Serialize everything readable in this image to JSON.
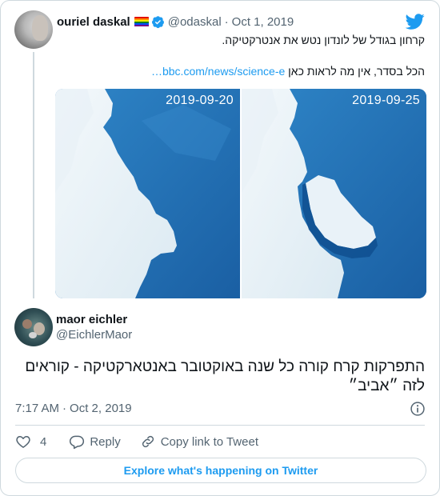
{
  "parent_tweet": {
    "author_name": "ouriel daskal",
    "handle": "@odaskal",
    "separator": "·",
    "date": "Oct 1, 2019",
    "text_line1": "קרחון בגודל של לונדון נטש את אנטרקטיקה.",
    "text_line2_prefix": "הכל בסדר, אין מה לראות כאן",
    "link_text": "bbc.com/news/science-e…",
    "images": [
      {
        "label": "2019-09-20"
      },
      {
        "label": "2019-09-25"
      }
    ]
  },
  "reply_tweet": {
    "author_name": "maor eichler",
    "handle": "@EichlerMaor",
    "text": "התפרקות קרח קורה כל שנה באוקטובר באנטארקטיקה - קוראים לזה ״אביב״",
    "time": "7:17 AM",
    "separator": "·",
    "date": "Oct 2, 2019"
  },
  "actions": {
    "like_count": "4",
    "reply_label": "Reply",
    "copy_label": "Copy link to Tweet"
  },
  "explore_label": "Explore what's happening on Twitter",
  "icons": {
    "brand": "twitter-bird-icon",
    "verified": "verified-badge-icon",
    "flag": "rainbow-flag-icon",
    "info": "info-icon",
    "like": "heart-icon",
    "reply": "speech-bubble-icon",
    "copy": "link-icon"
  },
  "colors": {
    "accent": "#1d9bf0",
    "secondary_text": "#536471",
    "border": "#cfd9de",
    "ocean": "#1f6fb6"
  }
}
